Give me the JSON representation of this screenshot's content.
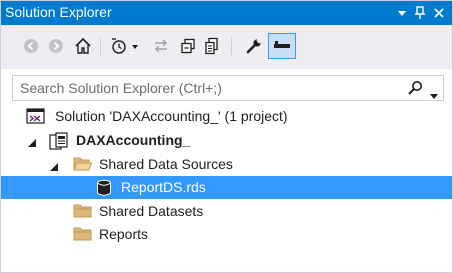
{
  "window": {
    "title": "Solution Explorer",
    "accent": "#007acc"
  },
  "title_controls": [
    {
      "name": "dropdown-arrow-icon",
      "glyph": "▾"
    },
    {
      "name": "pin-icon",
      "glyph": "⊥"
    },
    {
      "name": "close-icon",
      "glyph": "✕"
    }
  ],
  "toolbar": {
    "buttons": [
      {
        "name": "back-button",
        "icon": "back-arrow-icon",
        "enabled": false
      },
      {
        "name": "forward-button",
        "icon": "forward-arrow-icon",
        "enabled": false
      },
      {
        "name": "home-button",
        "icon": "home-icon",
        "enabled": true
      },
      {
        "name": "pending-changes-filter-button",
        "icon": "clock-icon",
        "enabled": true
      },
      {
        "name": "sync-with-active-document-button",
        "icon": "sync-arrows-icon",
        "enabled": false
      },
      {
        "name": "collapse-all-button",
        "icon": "collapse-all-icon",
        "enabled": true
      },
      {
        "name": "show-all-files-button",
        "icon": "show-all-files-icon",
        "enabled": true
      },
      {
        "name": "properties-button",
        "icon": "wrench-icon",
        "enabled": true
      },
      {
        "name": "preview-selected-items-button",
        "icon": "preview-icon",
        "enabled": true,
        "pressed": true
      }
    ]
  },
  "search": {
    "placeholder": "Search Solution Explorer (Ctrl+;)",
    "value": ""
  },
  "tree": {
    "selected_color": "#3399ff",
    "items": [
      {
        "label": "Solution 'DAXAccounting_' (1 project)",
        "icon": "solution-icon",
        "level": 0,
        "expander": "none",
        "bold": false,
        "selected": false
      },
      {
        "label": "DAXAccounting_",
        "icon": "report-project-icon",
        "level": 0,
        "expander": "expanded",
        "bold": true,
        "selected": false
      },
      {
        "label": "Shared Data Sources",
        "icon": "folder-open-icon",
        "level": 1,
        "expander": "expanded",
        "bold": false,
        "selected": false
      },
      {
        "label": "ReportDS.rds",
        "icon": "datasource-icon",
        "level": 2,
        "expander": "none",
        "bold": false,
        "selected": true
      },
      {
        "label": "Shared Datasets",
        "icon": "folder-icon",
        "level": 1,
        "expander": "none",
        "bold": false,
        "selected": false
      },
      {
        "label": "Reports",
        "icon": "folder-icon",
        "level": 1,
        "expander": "none",
        "bold": false,
        "selected": false
      }
    ]
  }
}
